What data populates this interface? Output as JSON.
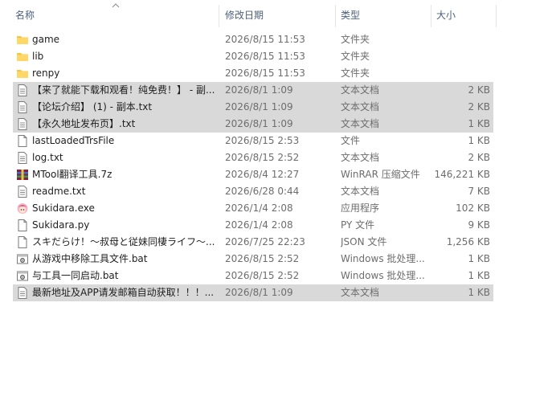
{
  "columns": {
    "name": "名称",
    "modified": "修改日期",
    "type": "类型",
    "size": "大小"
  },
  "files": [
    {
      "icon": "folder-icon",
      "name": "game",
      "date": "2026/8/15 11:53",
      "type": "文件夹",
      "size": "",
      "selected": false
    },
    {
      "icon": "folder-icon",
      "name": "lib",
      "date": "2026/8/15 11:53",
      "type": "文件夹",
      "size": "",
      "selected": false
    },
    {
      "icon": "folder-icon",
      "name": "renpy",
      "date": "2026/8/15 11:53",
      "type": "文件夹",
      "size": "",
      "selected": false
    },
    {
      "icon": "text-file-icon",
      "name": "【来了就能下载和观看！纯免费！】 - 副...",
      "date": "2026/8/1 1:09",
      "type": "文本文档",
      "size": "2 KB",
      "selected": true
    },
    {
      "icon": "text-file-icon",
      "name": "【论坛介绍】 (1) - 副本.txt",
      "date": "2026/8/1 1:09",
      "type": "文本文档",
      "size": "2 KB",
      "selected": true
    },
    {
      "icon": "text-file-icon",
      "name": "【永久地址发布页】.txt",
      "date": "2026/8/1 1:09",
      "type": "文本文档",
      "size": "1 KB",
      "selected": true
    },
    {
      "icon": "file-icon",
      "name": "lastLoadedTrsFile",
      "date": "2026/8/15 2:53",
      "type": "文件",
      "size": "1 KB",
      "selected": false
    },
    {
      "icon": "text-file-icon",
      "name": "log.txt",
      "date": "2026/8/15 2:52",
      "type": "文本文档",
      "size": "2 KB",
      "selected": false
    },
    {
      "icon": "winrar-archive-icon",
      "name": "MTool翻译工具.7z",
      "date": "2026/8/4 12:27",
      "type": "WinRAR 压缩文件",
      "size": "146,221 KB",
      "selected": false
    },
    {
      "icon": "text-file-icon",
      "name": "readme.txt",
      "date": "2026/6/28 0:44",
      "type": "文本文档",
      "size": "7 KB",
      "selected": false
    },
    {
      "icon": "anime-app-icon",
      "name": "Sukidara.exe",
      "date": "2026/1/4 2:08",
      "type": "应用程序",
      "size": "102 KB",
      "selected": false
    },
    {
      "icon": "python-file-icon",
      "name": "Sukidara.py",
      "date": "2026/1/4 2:08",
      "type": "PY 文件",
      "size": "9 KB",
      "selected": false
    },
    {
      "icon": "file-icon",
      "name": "スキだらけ！～叔母と従妹同棲ライフ～...",
      "date": "2026/7/25 22:23",
      "type": "JSON 文件",
      "size": "1,256 KB",
      "selected": false
    },
    {
      "icon": "batch-file-icon",
      "name": "从游戏中移除工具文件.bat",
      "date": "2026/8/15 2:52",
      "type": "Windows 批处理...",
      "size": "1 KB",
      "selected": false
    },
    {
      "icon": "batch-file-icon",
      "name": "与工具一同启动.bat",
      "date": "2026/8/15 2:52",
      "type": "Windows 批处理...",
      "size": "1 KB",
      "selected": false
    },
    {
      "icon": "text-file-icon",
      "name": "最新地址及APP请发邮箱自动获取！！！...",
      "date": "2026/8/1 1:09",
      "type": "文本文档",
      "size": "1 KB",
      "selected": true
    }
  ]
}
